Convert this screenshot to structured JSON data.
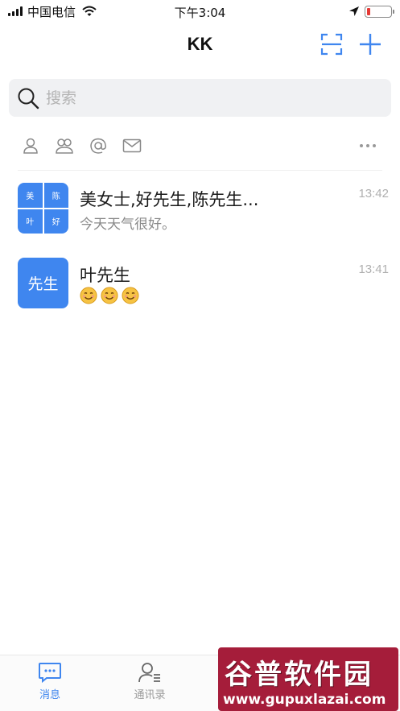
{
  "status_bar": {
    "carrier": "中国电信",
    "time": "下午3:04",
    "battery_level": 0.15
  },
  "nav": {
    "title": "KK",
    "scan_icon": "scan-icon",
    "add_icon": "plus-icon"
  },
  "search": {
    "placeholder": "搜索"
  },
  "filters": [
    "person-icon",
    "group-icon",
    "at-icon",
    "mail-icon",
    "more-icon"
  ],
  "conversations": [
    {
      "avatar_cells": [
        "美",
        "陈",
        "叶",
        "好"
      ],
      "name": "美女士,好先生,陈先生...",
      "preview": "今天天气很好。",
      "time": "13:42"
    },
    {
      "avatar_text": "先生",
      "name": "叶先生",
      "preview_emoji": [
        "smiling-face-icon",
        "smiling-face-icon",
        "smiling-face-icon"
      ],
      "time": "13:41"
    }
  ],
  "tabs": [
    {
      "label": "消息",
      "icon": "chat-icon",
      "active": true
    },
    {
      "label": "通讯录",
      "icon": "contacts-icon",
      "active": false
    }
  ],
  "colors": {
    "accent": "#3f86ef",
    "tab_active": "#3f86ef",
    "tab_inactive": "#9a9a9a"
  },
  "watermark": {
    "logo": "谷普软件园",
    "url": "www.gupuxlazai.com"
  }
}
